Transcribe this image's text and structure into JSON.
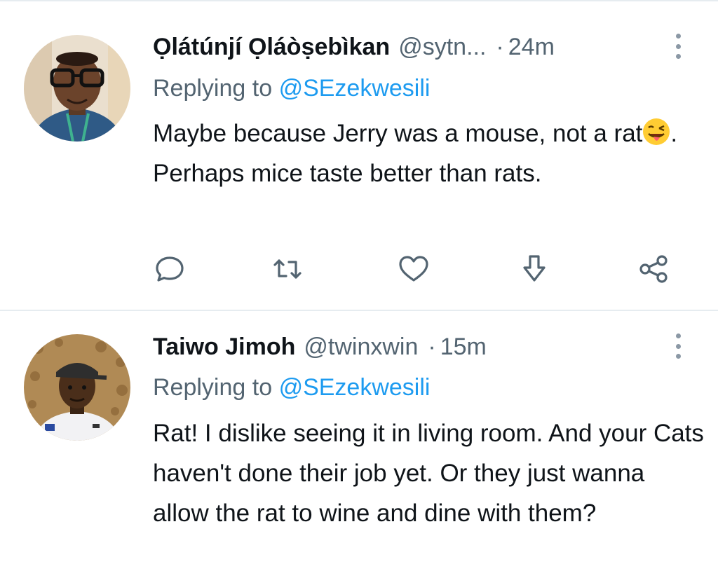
{
  "tweets": [
    {
      "name": "Ọlátúnjí Ọláòṣebìkan",
      "handle": "@sytn...",
      "separator": "·",
      "time": "24m",
      "replying_prefix": "Replying to",
      "replying_to": "@SEzekwesili",
      "text_part1": "Maybe because Jerry was a mouse, not a rat",
      "emoji": "winking-face-with-tongue",
      "text_part2": ". Perhaps mice taste better than rats."
    },
    {
      "name": "Taiwo Jimoh",
      "handle": "@twinxwin",
      "separator": "·",
      "time": "15m",
      "replying_prefix": "Replying to",
      "replying_to": "@SEzekwesili",
      "text": "Rat! I dislike seeing it in living room. And your Cats haven't done their job yet. Or they just wanna allow the rat to wine and dine with them?"
    }
  ],
  "action_icons": [
    "reply-icon",
    "retweet-icon",
    "like-icon",
    "download-icon",
    "share-icon"
  ],
  "colors": {
    "text": "#0f1419",
    "secondary": "#536471",
    "link": "#1d9bf0",
    "icon": "#536471",
    "divider": "#e6ecf0"
  }
}
